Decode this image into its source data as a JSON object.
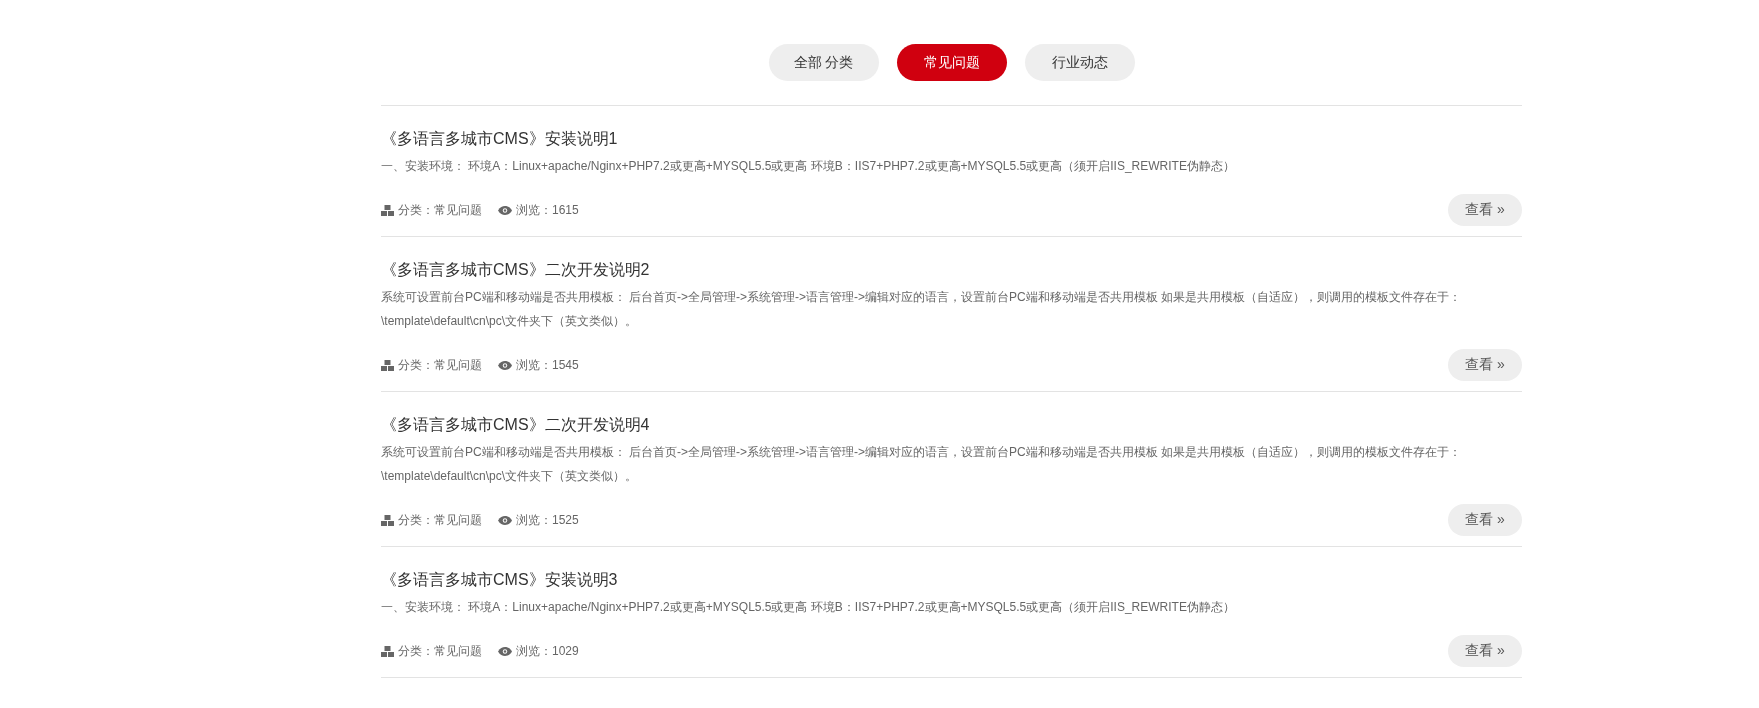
{
  "tabs": [
    {
      "label": "全部 分类",
      "selected": false
    },
    {
      "label": "常见问题",
      "selected": true
    },
    {
      "label": "行业动态",
      "selected": false
    }
  ],
  "articles": [
    {
      "title": "《多语言多城市CMS》安装说明1",
      "summary": "一、安装环境： 环境A：Linux+apache/Nginx+PHP7.2或更高+MYSQL5.5或更高 环境B：IIS7+PHP7.2或更高+MYSQL5.5或更高（须开启IIS_REWRITE伪静态）",
      "category": "分类：常见问题",
      "views": "浏览：1615",
      "button": "查看 »"
    },
    {
      "title": "《多语言多城市CMS》二次开发说明2",
      "summary": "系统可设置前台PC端和移动端是否共用模板： 后台首页->全局管理->系统管理->语言管理->编辑对应的语言，设置前台PC端和移动端是否共用模板 如果是共用模板（自适应），则调用的模板文件存在于：\\template\\default\\cn\\pc\\文件夹下（英文类似）。",
      "category": "分类：常见问题",
      "views": "浏览：1545",
      "button": "查看 »"
    },
    {
      "title": "《多语言多城市CMS》二次开发说明4",
      "summary": "系统可设置前台PC端和移动端是否共用模板： 后台首页->全局管理->系统管理->语言管理->编辑对应的语言，设置前台PC端和移动端是否共用模板 如果是共用模板（自适应），则调用的模板文件存在于：\\template\\default\\cn\\pc\\文件夹下（英文类似）。",
      "category": "分类：常见问题",
      "views": "浏览：1525",
      "button": "查看 »"
    },
    {
      "title": "《多语言多城市CMS》安装说明3",
      "summary": "一、安装环境： 环境A：Linux+apache/Nginx+PHP7.2或更高+MYSQL5.5或更高 环境B：IIS7+PHP7.2或更高+MYSQL5.5或更高（须开启IIS_REWRITE伪静态）",
      "category": "分类：常见问题",
      "views": "浏览：1029",
      "button": "查看 »"
    }
  ]
}
